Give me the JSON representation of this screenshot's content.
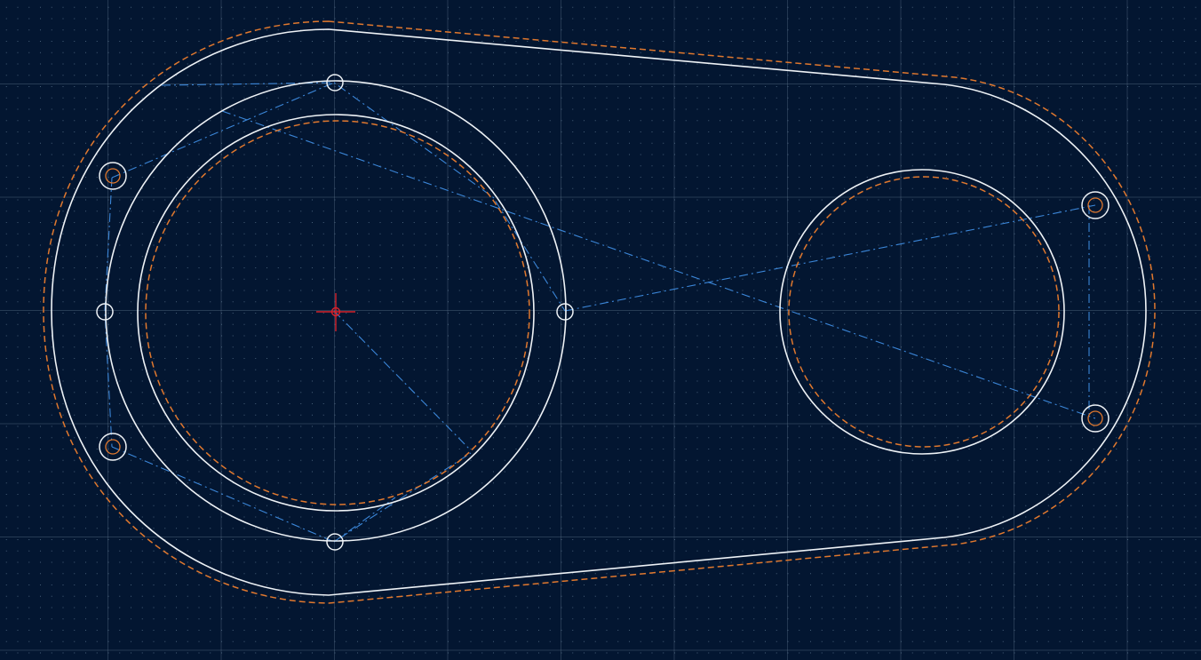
{
  "canvas": {
    "background": "#031631",
    "grid": true,
    "minor_grid_color": "#5c7690",
    "major_grid_color": "#5a7087",
    "geometry_color": "#eef2f6",
    "offset_color": "#e0782e",
    "construction_color": "#3b86d8",
    "origin_marker_color": "#d8222b"
  },
  "view": {
    "icons": [
      "origin-crosshair-icon"
    ]
  }
}
